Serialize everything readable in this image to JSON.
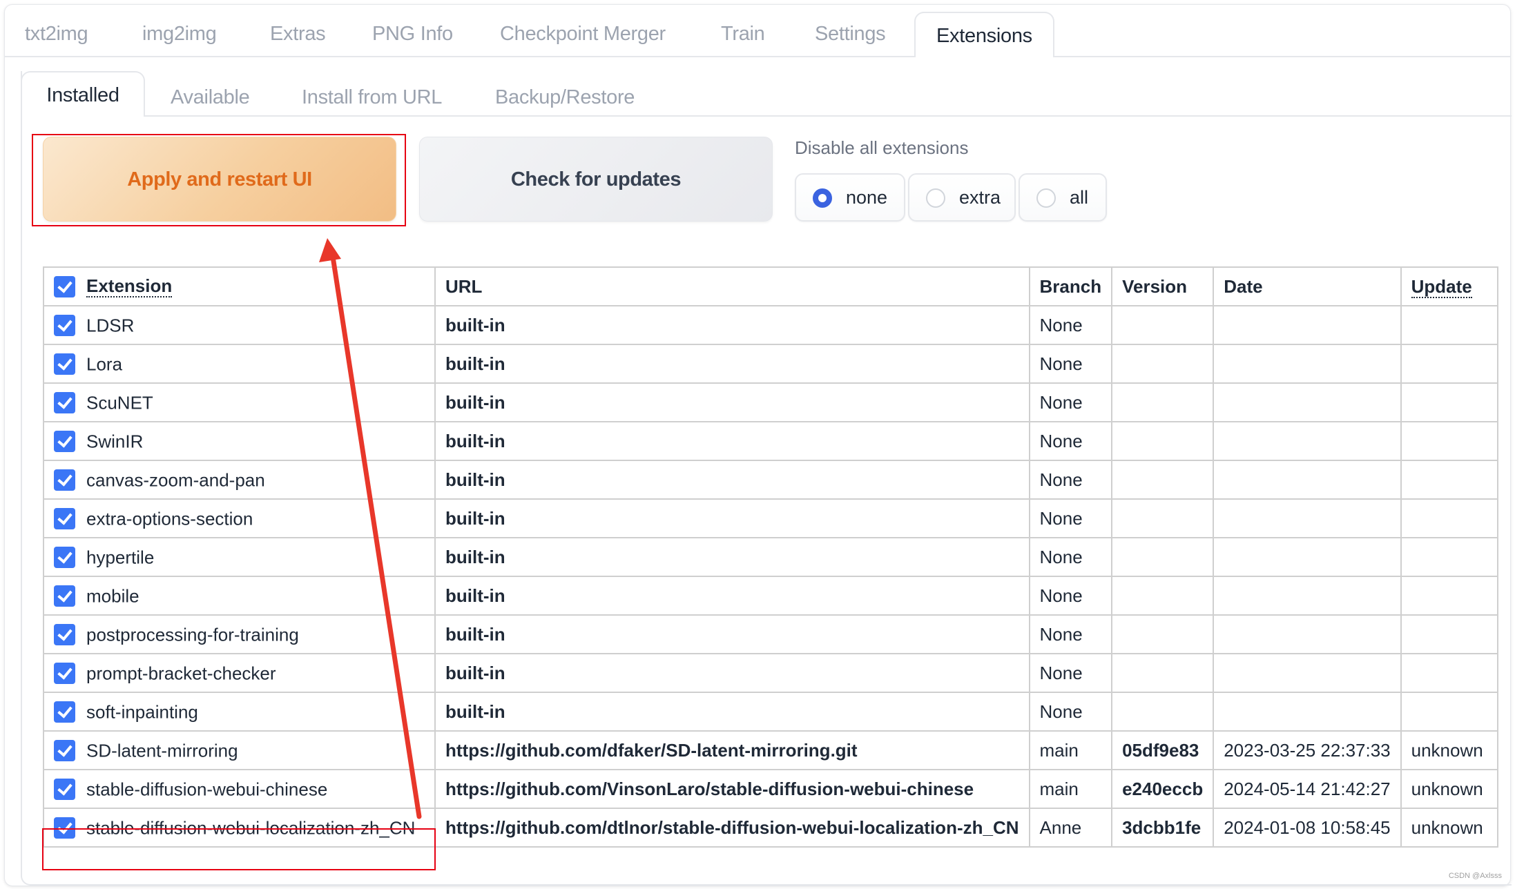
{
  "main_tabs": [
    {
      "label": "txt2img",
      "active": false
    },
    {
      "label": "img2img",
      "active": false
    },
    {
      "label": "Extras",
      "active": false
    },
    {
      "label": "PNG Info",
      "active": false
    },
    {
      "label": "Checkpoint Merger",
      "active": false
    },
    {
      "label": "Train",
      "active": false
    },
    {
      "label": "Settings",
      "active": false
    },
    {
      "label": "Extensions",
      "active": true
    }
  ],
  "sub_tabs": [
    {
      "label": "Installed",
      "active": true
    },
    {
      "label": "Available",
      "active": false
    },
    {
      "label": "Install from URL",
      "active": false
    },
    {
      "label": "Backup/Restore",
      "active": false
    }
  ],
  "actions": {
    "apply_label": "Apply and restart UI",
    "check_label": "Check for updates"
  },
  "disable_all": {
    "label": "Disable all extensions",
    "options": [
      "none",
      "extra",
      "all"
    ],
    "selected": "none"
  },
  "table": {
    "headers": {
      "extension": "Extension",
      "url": "URL",
      "branch": "Branch",
      "version": "Version",
      "date": "Date",
      "update": "Update"
    },
    "select_all_checked": true,
    "rows": [
      {
        "checked": true,
        "name": "LDSR",
        "url": "built-in",
        "branch": "None",
        "version": "",
        "date": "",
        "update": ""
      },
      {
        "checked": true,
        "name": "Lora",
        "url": "built-in",
        "branch": "None",
        "version": "",
        "date": "",
        "update": ""
      },
      {
        "checked": true,
        "name": "ScuNET",
        "url": "built-in",
        "branch": "None",
        "version": "",
        "date": "",
        "update": ""
      },
      {
        "checked": true,
        "name": "SwinIR",
        "url": "built-in",
        "branch": "None",
        "version": "",
        "date": "",
        "update": ""
      },
      {
        "checked": true,
        "name": "canvas-zoom-and-pan",
        "url": "built-in",
        "branch": "None",
        "version": "",
        "date": "",
        "update": ""
      },
      {
        "checked": true,
        "name": "extra-options-section",
        "url": "built-in",
        "branch": "None",
        "version": "",
        "date": "",
        "update": ""
      },
      {
        "checked": true,
        "name": "hypertile",
        "url": "built-in",
        "branch": "None",
        "version": "",
        "date": "",
        "update": ""
      },
      {
        "checked": true,
        "name": "mobile",
        "url": "built-in",
        "branch": "None",
        "version": "",
        "date": "",
        "update": ""
      },
      {
        "checked": true,
        "name": "postprocessing-for-training",
        "url": "built-in",
        "branch": "None",
        "version": "",
        "date": "",
        "update": ""
      },
      {
        "checked": true,
        "name": "prompt-bracket-checker",
        "url": "built-in",
        "branch": "None",
        "version": "",
        "date": "",
        "update": ""
      },
      {
        "checked": true,
        "name": "soft-inpainting",
        "url": "built-in",
        "branch": "None",
        "version": "",
        "date": "",
        "update": ""
      },
      {
        "checked": true,
        "name": "SD-latent-mirroring",
        "url": "https://github.com/dfaker/SD-latent-mirroring.git",
        "branch": "main",
        "version": "05df9e83",
        "date": "2023-03-25 22:37:33",
        "update": "unknown"
      },
      {
        "checked": true,
        "name": "stable-diffusion-webui-chinese",
        "url": "https://github.com/VinsonLaro/stable-diffusion-webui-chinese",
        "branch": "main",
        "version": "e240eccb",
        "date": "2024-05-14 21:42:27",
        "update": "unknown"
      },
      {
        "checked": true,
        "name": "stable-diffusion-webui-localization-zh_CN",
        "url": "https://github.com/dtlnor/stable-diffusion-webui-localization-zh_CN",
        "branch": "Anne",
        "version": "3dcbb1fe",
        "date": "2024-01-08 10:58:45",
        "update": "unknown"
      }
    ]
  },
  "annotations": {
    "highlight_color": "#e60012",
    "arrow_color": "#e8372a"
  },
  "watermark": "CSDN @Axlsss"
}
